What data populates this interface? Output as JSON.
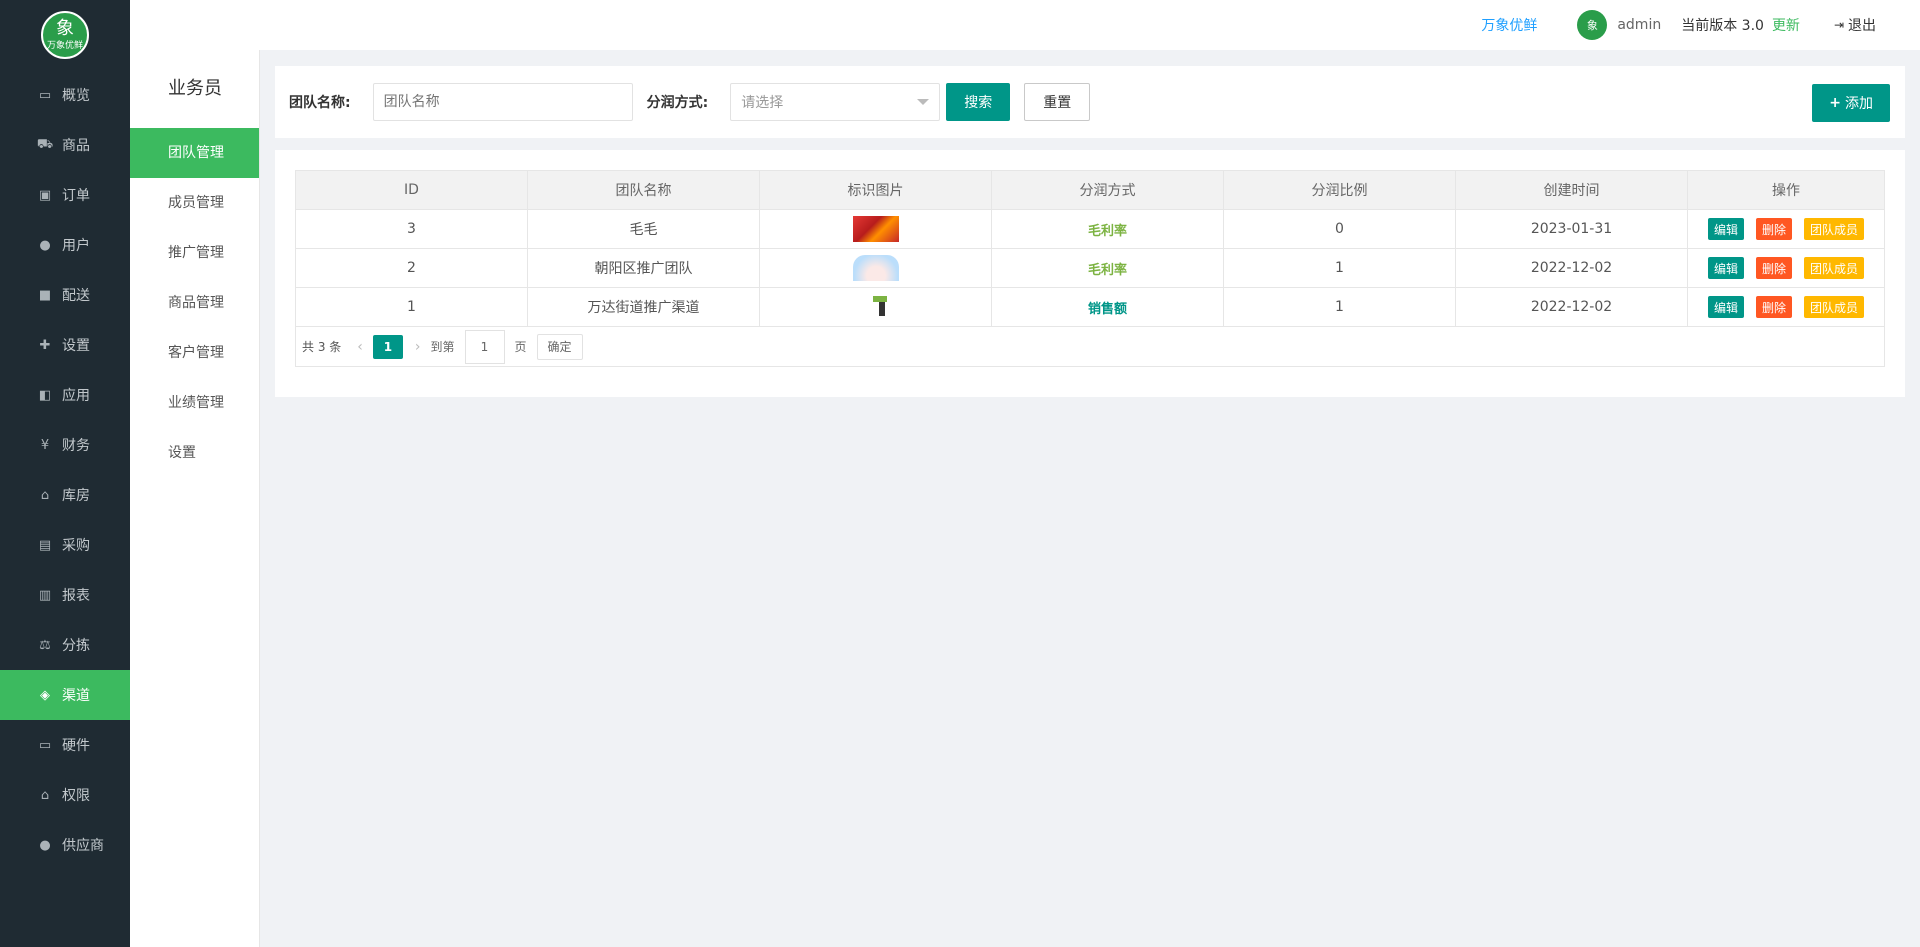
{
  "logo": {
    "text": "万象优鲜"
  },
  "sidebar": {
    "items": [
      {
        "label": "概览",
        "icon": "monitor-icon"
      },
      {
        "label": "商品",
        "icon": "cart-icon"
      },
      {
        "label": "订单",
        "icon": "money-icon"
      },
      {
        "label": "用户",
        "icon": "users-icon"
      },
      {
        "label": "配送",
        "icon": "truck-icon"
      },
      {
        "label": "设置",
        "icon": "puzzle-icon"
      },
      {
        "label": "应用",
        "icon": "apps-icon"
      },
      {
        "label": "财务",
        "icon": "yen-icon"
      },
      {
        "label": "库房",
        "icon": "home-icon"
      },
      {
        "label": "采购",
        "icon": "bus-icon"
      },
      {
        "label": "报表",
        "icon": "bar-chart-icon"
      },
      {
        "label": "分拣",
        "icon": "scale-icon"
      },
      {
        "label": "渠道",
        "icon": "cube-icon",
        "active": true
      },
      {
        "label": "硬件",
        "icon": "desktop-icon"
      },
      {
        "label": "权限",
        "icon": "bank-icon"
      },
      {
        "label": "供应商",
        "icon": "group-icon"
      }
    ]
  },
  "subnav": {
    "title": "业务员",
    "items": [
      "团队管理",
      "成员管理",
      "推广管理",
      "商品管理",
      "客户管理",
      "业绩管理",
      "设置"
    ]
  },
  "header": {
    "brand_link": "万象优鲜",
    "user": "admin",
    "version_label": "当前版本  3.0",
    "update": "更新",
    "logout": "退出"
  },
  "filter": {
    "team_label": "团队名称:",
    "team_placeholder": "团队名称",
    "split_label": "分润方式:",
    "split_placeholder": "请选择",
    "search": "搜索",
    "reset": "重置",
    "add": "添加"
  },
  "table": {
    "headers": [
      "ID",
      "团队名称",
      "标识图片",
      "分润方式",
      "分润比例",
      "创建时间",
      "操作"
    ],
    "rows": [
      {
        "id": "3",
        "name": "毛毛",
        "method": "毛利率",
        "ratio": "0",
        "created": "2023-01-31"
      },
      {
        "id": "2",
        "name": "朝阳区推广团队",
        "method": "毛利率",
        "ratio": "1",
        "created": "2022-12-02"
      },
      {
        "id": "1",
        "name": "万达街道推广渠道",
        "method": "销售额",
        "ratio": "1",
        "created": "2022-12-02"
      }
    ],
    "actions": {
      "edit": "编辑",
      "delete": "删除",
      "members": "团队成员"
    }
  },
  "pager": {
    "total": "共 3 条",
    "current": "1",
    "goto": "到第",
    "page_value": "1",
    "page_unit": "页",
    "confirm": "确定"
  },
  "colors": {
    "accent": "#009688",
    "active_nav": "#3cba5f",
    "sidebar_bg": "#1f2b33"
  }
}
